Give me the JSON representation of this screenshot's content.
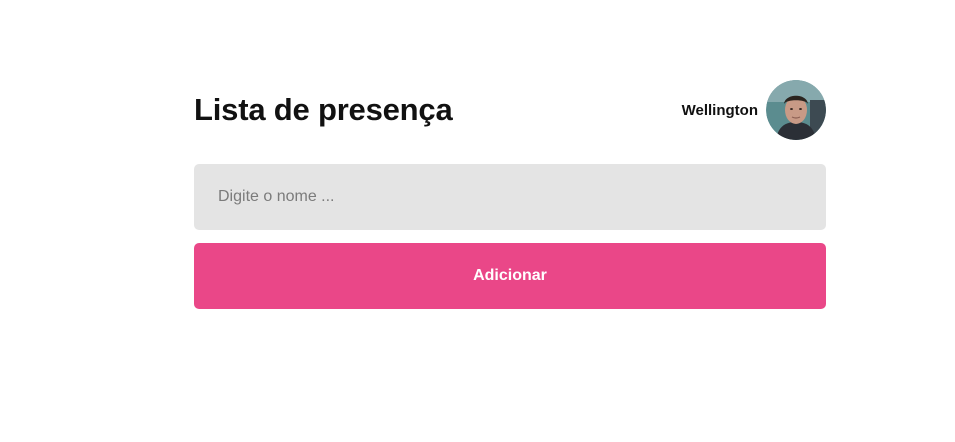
{
  "page": {
    "title": "Lista de presença"
  },
  "user": {
    "name": "Wellington",
    "avatar_icon": "user-photo"
  },
  "form": {
    "name_input": {
      "placeholder": "Digite o nome ...",
      "value": ""
    },
    "add_button_label": "Adicionar"
  },
  "colors": {
    "accent": "#ea4788",
    "input_background": "#e4e4e4",
    "text": "#111111"
  }
}
